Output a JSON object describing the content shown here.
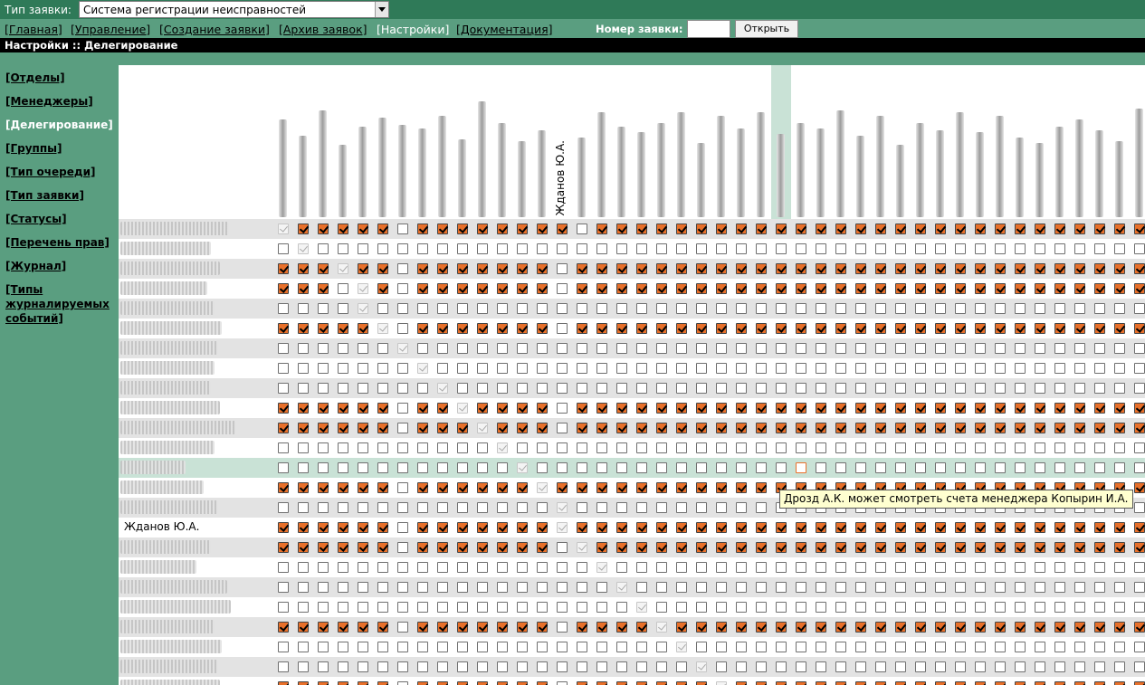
{
  "header": {
    "type_label": "Тип заявки:",
    "type_value": "Система регистрации неисправностей"
  },
  "nav": {
    "links": [
      "[Главная]",
      "[Управление]",
      "[Создание заявки]",
      "[Архив заявок]",
      "[Настройки]",
      "[Документация]"
    ],
    "active": "[Настройки]",
    "number_label": "Номер заявки:",
    "number_value": "",
    "open_button": "Открыть"
  },
  "breadcrumb": "Настройки :: Делегирование",
  "sidebar": {
    "items": [
      "[Отделы]",
      "[Менеджеры]",
      "[Делегирование]",
      "[Группы]",
      "[Тип очереди]",
      "[Тип заявки]",
      "[Статусы]",
      "[Перечень прав]",
      "[Журнал]",
      "[Типы журналируемых событий]"
    ],
    "active": "[Делегирование]"
  },
  "matrix": {
    "visible_column_name": "Жданов Ю.А.",
    "visible_row_name": "Жданов Ю.А.",
    "highlighted_column": 25,
    "highlighted_row": 12,
    "columns_count": 44,
    "rows": [
      "d1111101111111101111111111111111111111111111",
      "0d00000000000000000000000000000000000000000000",
      "111d11011111110111111111111111111111111111111",
      "1110d1011111110111111111111111111111111111111",
      "0000d0000000000000000000000000000000000000000",
      "11111d011111110111111111111111111111111111111",
      "000000d0000000000000000000000000000000000000",
      "0000000d000000000000000000000000000000000000",
      "00000000d00000000000000000000000000000000000",
      "111111011d1111011111111111111111111111111111",
      "1111110111d111011111111111111111111111111111",
      "00000000000d00000000000000000000000000000000",
      "000000000000d0000000000000m00000000000000000",
      "1111110111111d111111111111111111111111111111",
      "00000000000000d00000000000000000000000000000",
      "11111101111111d11111111111111111111111111111",
      "111111011111110d1111111111111111111111111111",
      "0000000000000000d000000000000000000000000000",
      "00000000000000000d00000000000000000000000000",
      "000000000000000000d0000000000000000000000000",
      "1111110111111101111d111111111111111111111111",
      "00000000000000000000d00000000000000000000000",
      "000000000000000000000d0000000000000000000000",
      "1111110111111101111111d111111111111111111111"
    ],
    "tooltip": "Дрозд А.К. может смотреть счета менеджера Копырин И.А."
  }
}
